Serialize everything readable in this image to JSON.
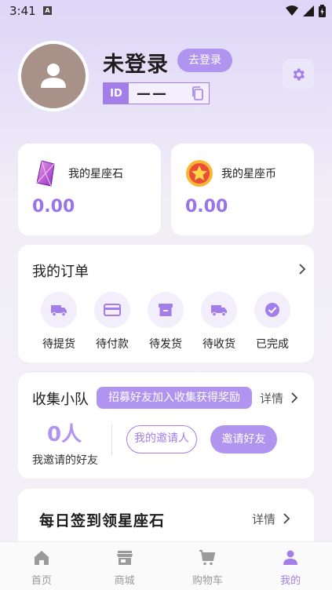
{
  "status_bar": {
    "time": "3:41",
    "notif_letter": "A"
  },
  "profile": {
    "title": "未登录",
    "login_label": "去登录",
    "id_label": "ID",
    "id_value": "——"
  },
  "wallet": [
    {
      "label": "我的星座石",
      "value": "0.00",
      "icon": "gem-icon"
    },
    {
      "label": "我的星座币",
      "value": "0.00",
      "icon": "star-coin-icon"
    }
  ],
  "orders": {
    "title": "我的订单",
    "items": [
      {
        "label": "待提货",
        "icon": "truck-icon"
      },
      {
        "label": "待付款",
        "icon": "card-icon"
      },
      {
        "label": "待发货",
        "icon": "box-icon"
      },
      {
        "label": "待收货",
        "icon": "delivery-truck-icon"
      },
      {
        "label": "已完成",
        "icon": "check-circle-icon"
      }
    ]
  },
  "team": {
    "title": "收集小队",
    "banner": "招募好友加入收集获得奖励",
    "detail": "详情",
    "count": "0人",
    "count_label": "我邀请的好友",
    "inviter_btn": "我的邀请人",
    "invite_btn": "邀请好友"
  },
  "checkin": {
    "title": "每日签到领星座石",
    "detail": "详情"
  },
  "nav": [
    {
      "label": "首页",
      "icon": "home-icon",
      "active": false
    },
    {
      "label": "商城",
      "icon": "store-icon",
      "active": false
    },
    {
      "label": "购物车",
      "icon": "cart-icon",
      "active": false
    },
    {
      "label": "我的",
      "icon": "person-icon",
      "active": true
    }
  ],
  "colors": {
    "accent": "#a37ee9",
    "accent_light": "#b193f0",
    "value": "#9a73e4"
  }
}
